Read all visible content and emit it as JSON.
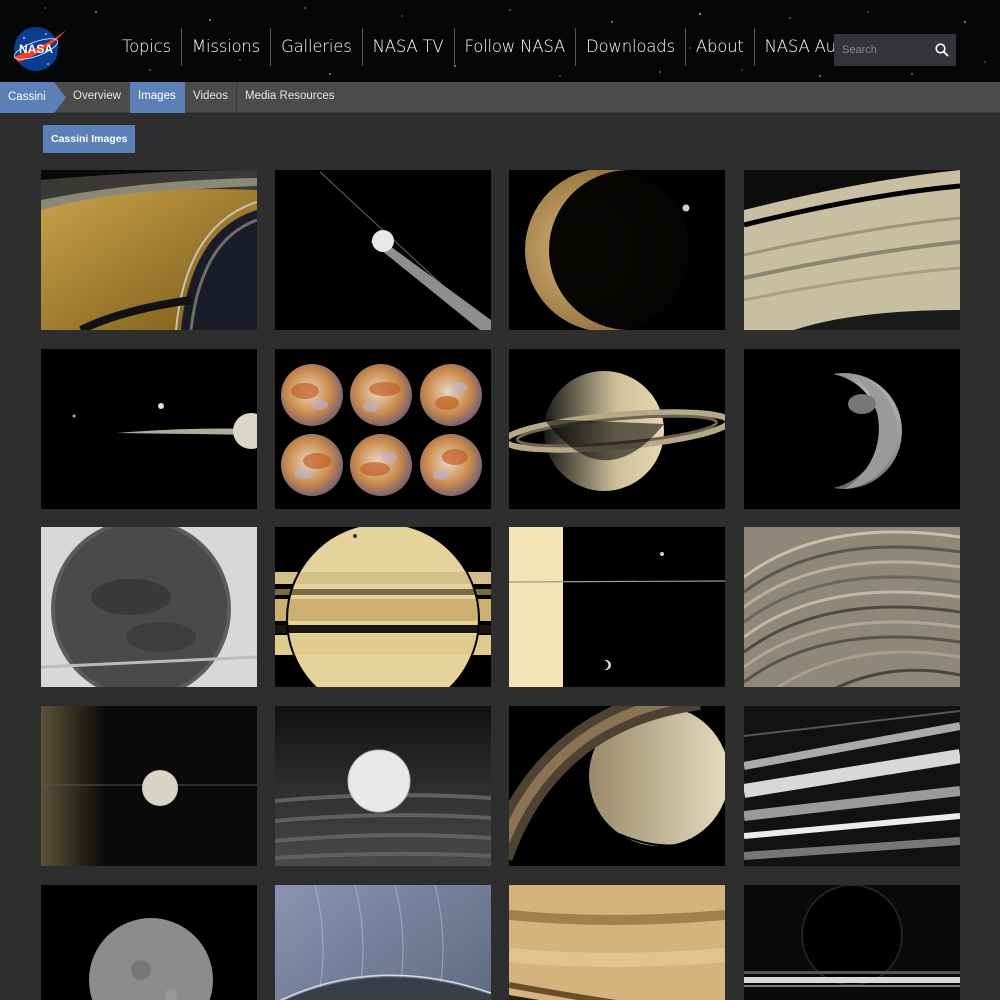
{
  "header": {
    "logo_text": "NASA",
    "nav_items": [
      "Topics",
      "Missions",
      "Galleries",
      "NASA TV",
      "Follow NASA",
      "Downloads",
      "About",
      "NASA Audiences"
    ],
    "search_placeholder": "Search",
    "icons": {
      "search": "search-icon"
    }
  },
  "subnav": {
    "breadcrumb": "Cassini",
    "tabs": [
      {
        "label": "Overview",
        "active": false
      },
      {
        "label": "Images",
        "active": true
      },
      {
        "label": "Videos",
        "active": false
      },
      {
        "label": "Media Resources",
        "active": false
      }
    ]
  },
  "main": {
    "section_label": "Cassini Images",
    "thumbnails": [
      "saturn-rings-limb",
      "tethys-ring-plane",
      "titan-crescent",
      "rings-closeup",
      "moons-ring-plane",
      "titan-mosaic",
      "saturn-ringed-globe",
      "tethys-crescent",
      "titan-monochrome",
      "saturn-belts",
      "saturn-limb-moons",
      "ring-ringlets",
      "dione-ring-edge",
      "enceladus-rings",
      "saturn-crescent-rings",
      "rings-monochrome",
      "mimas-grey",
      "rings-blue-tint",
      "saturn-amber-close",
      "eclipsed-saturn"
    ]
  },
  "colors": {
    "accent": "#5b7fb7",
    "background": "#2e2e2e",
    "header": "#050608",
    "subnav": "#4b4b4b"
  }
}
